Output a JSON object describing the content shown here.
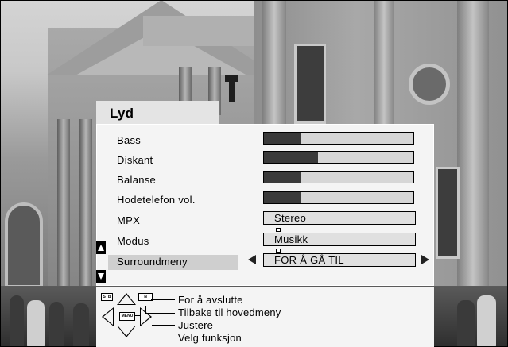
{
  "menu": {
    "title": "Lyd",
    "rows": [
      {
        "label": "Bass",
        "type": "slider",
        "level": 0.25
      },
      {
        "label": "Diskant",
        "type": "slider",
        "level": 0.36
      },
      {
        "label": "Balanse",
        "type": "slider",
        "level": 0.25
      },
      {
        "label": "Hodetelefon vol.",
        "type": "slider",
        "level": 0.25
      },
      {
        "label": "MPX",
        "type": "select",
        "value": "Stereo"
      },
      {
        "label": "Modus",
        "type": "select",
        "value": "Musikk"
      },
      {
        "label": "Surroundmeny",
        "type": "submenu",
        "value": "FOR Å GÅ TIL",
        "selected": true
      }
    ]
  },
  "help": {
    "key_stb": "STB",
    "key_menu_small": "N",
    "key_menu": "MENU",
    "exit": "For å avslutte",
    "back": "Tilbake til hovedmeny",
    "adjust": "Justere",
    "select": "Velg funksjon"
  },
  "colors": {
    "menu_bg": "#f4f4f4",
    "highlight": "#cfcfcf",
    "bar_fill": "#3a3a3a",
    "bar_track": "#d6d6d6"
  }
}
